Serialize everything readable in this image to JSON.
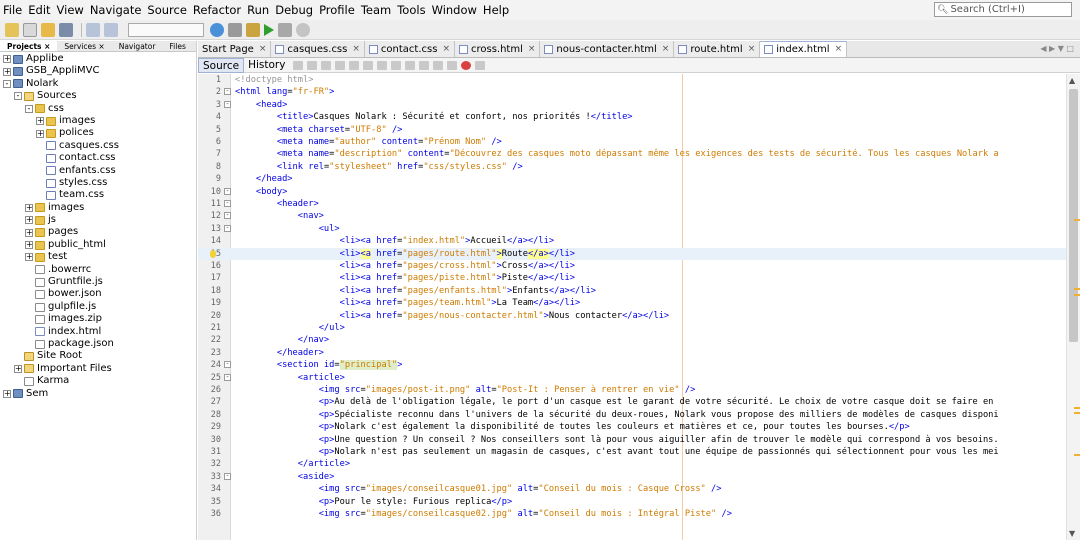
{
  "menu": [
    "File",
    "Edit",
    "View",
    "Navigate",
    "Source",
    "Refactor",
    "Run",
    "Debug",
    "Profile",
    "Team",
    "Tools",
    "Window",
    "Help"
  ],
  "search": {
    "placeholder": "Search (Ctrl+I)"
  },
  "projects_tabs": [
    "Projects",
    "Services",
    "Navigator",
    "Files"
  ],
  "tree": [
    {
      "label": "Applibe",
      "depth": 0,
      "toggle": "+",
      "icon": "proj"
    },
    {
      "label": "GSB_AppliMVC",
      "depth": 0,
      "toggle": "+",
      "icon": "proj"
    },
    {
      "label": "Nolark",
      "depth": 0,
      "toggle": "-",
      "icon": "proj"
    },
    {
      "label": "Sources",
      "depth": 1,
      "toggle": "-",
      "icon": "pkg"
    },
    {
      "label": "css",
      "depth": 2,
      "toggle": "-",
      "icon": "folder"
    },
    {
      "label": "images",
      "depth": 3,
      "toggle": "+",
      "icon": "folder"
    },
    {
      "label": "polices",
      "depth": 3,
      "toggle": "+",
      "icon": "folder"
    },
    {
      "label": "casques.css",
      "depth": 3,
      "toggle": "",
      "icon": "css"
    },
    {
      "label": "contact.css",
      "depth": 3,
      "toggle": "",
      "icon": "css"
    },
    {
      "label": "enfants.css",
      "depth": 3,
      "toggle": "",
      "icon": "css"
    },
    {
      "label": "styles.css",
      "depth": 3,
      "toggle": "",
      "icon": "css"
    },
    {
      "label": "team.css",
      "depth": 3,
      "toggle": "",
      "icon": "css"
    },
    {
      "label": "images",
      "depth": 2,
      "toggle": "+",
      "icon": "folder"
    },
    {
      "label": "js",
      "depth": 2,
      "toggle": "+",
      "icon": "folder"
    },
    {
      "label": "pages",
      "depth": 2,
      "toggle": "+",
      "icon": "folder"
    },
    {
      "label": "public_html",
      "depth": 2,
      "toggle": "+",
      "icon": "folder"
    },
    {
      "label": "test",
      "depth": 2,
      "toggle": "+",
      "icon": "folder"
    },
    {
      "label": ".bowerrc",
      "depth": 2,
      "toggle": "",
      "icon": "file"
    },
    {
      "label": "Gruntfile.js",
      "depth": 2,
      "toggle": "",
      "icon": "file"
    },
    {
      "label": "bower.json",
      "depth": 2,
      "toggle": "",
      "icon": "file"
    },
    {
      "label": "gulpfile.js",
      "depth": 2,
      "toggle": "",
      "icon": "file"
    },
    {
      "label": "images.zip",
      "depth": 2,
      "toggle": "",
      "icon": "file"
    },
    {
      "label": "index.html",
      "depth": 2,
      "toggle": "",
      "icon": "html"
    },
    {
      "label": "package.json",
      "depth": 2,
      "toggle": "",
      "icon": "file"
    },
    {
      "label": "Site Root",
      "depth": 1,
      "toggle": "",
      "icon": "pkg"
    },
    {
      "label": "Important Files",
      "depth": 1,
      "toggle": "+",
      "icon": "pkg"
    },
    {
      "label": "Karma",
      "depth": 1,
      "toggle": "",
      "icon": "file"
    },
    {
      "label": "Sem",
      "depth": 0,
      "toggle": "+",
      "icon": "proj"
    }
  ],
  "editor_tabs": [
    {
      "label": "Start Page",
      "active": false
    },
    {
      "label": "casques.css",
      "active": false
    },
    {
      "label": "contact.css",
      "active": false
    },
    {
      "label": "cross.html",
      "active": false
    },
    {
      "label": "nous-contacter.html",
      "active": false
    },
    {
      "label": "route.html",
      "active": false
    },
    {
      "label": "index.html",
      "active": true
    }
  ],
  "source_tabs": [
    "Source",
    "History"
  ],
  "code_lines": [
    {
      "n": 1,
      "html": "<span class='cm'>&lt;!doctype html&gt;</span>"
    },
    {
      "n": 2,
      "html": "<span class='tag'>&lt;html</span> <span class='an'>lang</span>=<span class='av'>\"fr-FR\"</span><span class='tag'>&gt;</span>"
    },
    {
      "n": 3,
      "html": "    <span class='tag'>&lt;head&gt;</span>"
    },
    {
      "n": 4,
      "html": "        <span class='tag'>&lt;title&gt;</span>Casques Nolark : Sécurité et confort, nos priorités !<span class='tag'>&lt;/title&gt;</span>"
    },
    {
      "n": 5,
      "html": "        <span class='tag'>&lt;meta</span> <span class='an'>charset</span>=<span class='av'>\"UTF-8\"</span> <span class='tag'>/&gt;</span>"
    },
    {
      "n": 6,
      "html": "        <span class='tag'>&lt;meta</span> <span class='an'>name</span>=<span class='av'>\"author\"</span> <span class='an'>content</span>=<span class='av'>\"Prénom Nom\"</span> <span class='tag'>/&gt;</span>"
    },
    {
      "n": 7,
      "html": "        <span class='tag'>&lt;meta</span> <span class='an'>name</span>=<span class='av'>\"description\"</span> <span class='an'>content</span>=<span class='av'>\"Découvrez des casques moto dépassant même les exigences des tests de sécurité. Tous les casques Nolark a</span>"
    },
    {
      "n": 8,
      "html": "        <span class='tag'>&lt;link</span> <span class='an'>rel</span>=<span class='av'>\"stylesheet\"</span> <span class='an'>href</span>=<span class='av'>\"css/styles.css\"</span> <span class='tag'>/&gt;</span>"
    },
    {
      "n": 9,
      "html": "    <span class='tag'>&lt;/head&gt;</span>"
    },
    {
      "n": 10,
      "html": "    <span class='tag'>&lt;body&gt;</span>"
    },
    {
      "n": 11,
      "html": "        <span class='tag'>&lt;header&gt;</span>"
    },
    {
      "n": 12,
      "html": "            <span class='tag'>&lt;nav&gt;</span>"
    },
    {
      "n": 13,
      "html": "                <span class='tag'>&lt;ul&gt;</span>"
    },
    {
      "n": 14,
      "html": "                    <span class='tag'>&lt;li&gt;&lt;a</span> <span class='an'>href</span>=<span class='av'>\"index.html\"</span><span class='tag'>&gt;</span>Accueil<span class='tag'>&lt;/a&gt;&lt;/li&gt;</span>"
    },
    {
      "n": 15,
      "html": "                    <span class='tag'>&lt;li&gt;<span class='mk'>&lt;a</span></span> <span class='an'>href</span>=<span class='av'>\"pages/route.html\"</span><span class='tag mk'>&gt;</span>Route<span class='tag mk'>&lt;/a&gt;</span><span class='tag'>&lt;/li&gt;</span>"
    },
    {
      "n": 16,
      "html": "                    <span class='tag'>&lt;li&gt;&lt;a</span> <span class='an'>href</span>=<span class='av'>\"pages/cross.html\"</span><span class='tag'>&gt;</span>Cross<span class='tag'>&lt;/a&gt;&lt;/li&gt;</span>"
    },
    {
      "n": 17,
      "html": "                    <span class='tag'>&lt;li&gt;&lt;a</span> <span class='an'>href</span>=<span class='av'>\"pages/piste.html\"</span><span class='tag'>&gt;</span>Piste<span class='tag'>&lt;/a&gt;&lt;/li&gt;</span>"
    },
    {
      "n": 18,
      "html": "                    <span class='tag'>&lt;li&gt;&lt;a</span> <span class='an'>href</span>=<span class='av'>\"pages/enfants.html\"</span><span class='tag'>&gt;</span>Enfants<span class='tag'>&lt;/a&gt;&lt;/li&gt;</span>"
    },
    {
      "n": 19,
      "html": "                    <span class='tag'>&lt;li&gt;&lt;a</span> <span class='an'>href</span>=<span class='av'>\"pages/team.html\"</span><span class='tag'>&gt;</span>La Team<span class='tag'>&lt;/a&gt;&lt;/li&gt;</span>"
    },
    {
      "n": 20,
      "html": "                    <span class='tag'>&lt;li&gt;&lt;a</span> <span class='an'>href</span>=<span class='av'>\"pages/nous-contacter.html\"</span><span class='tag'>&gt;</span>Nous contacter<span class='tag'>&lt;/a&gt;&lt;/li&gt;</span>"
    },
    {
      "n": 21,
      "html": "                <span class='tag'>&lt;/ul&gt;</span>"
    },
    {
      "n": 22,
      "html": "            <span class='tag'>&lt;/nav&gt;</span>"
    },
    {
      "n": 23,
      "html": "        <span class='tag'>&lt;/header&gt;</span>"
    },
    {
      "n": 24,
      "html": "        <span class='tag'>&lt;section</span> <span class='an'>id</span>=<span class='av sel'>\"principal\"</span><span class='tag'>&gt;</span>"
    },
    {
      "n": 25,
      "html": "            <span class='tag'>&lt;article&gt;</span>"
    },
    {
      "n": 26,
      "html": "                <span class='tag'>&lt;img</span> <span class='an'>src</span>=<span class='av'>\"images/post-it.png\"</span> <span class='an'>alt</span>=<span class='av'>\"Post-It : Penser à rentrer en vie\"</span> <span class='tag'>/&gt;</span>"
    },
    {
      "n": 27,
      "html": "                <span class='tag'>&lt;p&gt;</span>Au delà de l'obligation légale, le port d'un casque est le garant de votre sécurité. Le choix de votre casque doit se faire en"
    },
    {
      "n": 28,
      "html": "                <span class='tag'>&lt;p&gt;</span>Spécialiste reconnu dans l'univers de la sécurité du deux-roues, Nolark vous propose des milliers de modèles de casques disponi"
    },
    {
      "n": 29,
      "html": "                <span class='tag'>&lt;p&gt;</span>Nolark c'est également la disponibilité de toutes les couleurs et matières et ce, pour toutes les bourses.<span class='tag'>&lt;/p&gt;</span>"
    },
    {
      "n": 30,
      "html": "                <span class='tag'>&lt;p&gt;</span>Une question ? Un conseil ? Nos conseillers sont là pour vous aiguiller afin de trouver le modèle qui correspond à vos besoins."
    },
    {
      "n": 31,
      "html": "                <span class='tag'>&lt;p&gt;</span>Nolark n'est pas seulement un magasin de casques, c'est avant tout une équipe de passionnés qui sélectionnent pour vous les mei"
    },
    {
      "n": 32,
      "html": "            <span class='tag'>&lt;/article&gt;</span>"
    },
    {
      "n": 33,
      "html": "            <span class='tag'>&lt;aside&gt;</span>"
    },
    {
      "n": 34,
      "html": "                <span class='tag'>&lt;img</span> <span class='an'>src</span>=<span class='av'>\"images/conseilcasque01.jpg\"</span> <span class='an'>alt</span>=<span class='av'>\"Conseil du mois : Casque Cross\"</span> <span class='tag'>/&gt;</span>"
    },
    {
      "n": 35,
      "html": "                <span class='tag'>&lt;p&gt;</span>Pour le style: Furious replica<span class='tag'>&lt;/p&gt;</span>"
    },
    {
      "n": 36,
      "html": "                <span class='tag'>&lt;img</span> <span class='an'>src</span>=<span class='av'>\"images/conseilcasque02.jpg\"</span> <span class='an'>alt</span>=<span class='av'>\"Conseil du mois : Intégral Piste\"</span> <span class='tag'>/&gt;</span>"
    }
  ],
  "highlighted_line": 15,
  "fold_lines": {
    "2": "-",
    "3": "-",
    "10": "-",
    "11": "-",
    "12": "-",
    "13": "-",
    "24": "-",
    "25": "-",
    "33": "-"
  },
  "colors": {
    "tag": "#0000e6",
    "attr_value": "#ce7b00",
    "comment": "#969696",
    "highlight": "#e8f0fa"
  }
}
